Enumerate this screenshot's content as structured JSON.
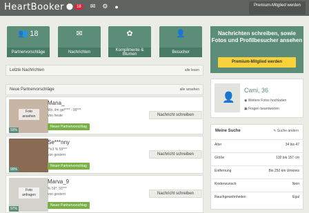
{
  "topbar": {
    "logo": "HeartBooker",
    "badge_count": "18",
    "premium_button": "Premium-Mitglied werden"
  },
  "tiles": [
    {
      "count": "18",
      "label": "Partnervorschläge"
    },
    {
      "label": "Nachrichten"
    },
    {
      "label": "Komplimente & Blumen"
    },
    {
      "label": "Besucher"
    }
  ],
  "latest": {
    "title": "Letzte Nachrichten",
    "more": "alle lesen"
  },
  "suggestions": {
    "title": "Neue Partnervorschläge",
    "more": "alle ansehen",
    "items": [
      {
        "name": "Mana_",
        "details": "Wo, ilm gel**** · 99***",
        "seen": "von heute",
        "tag": "Neuer Partnervorschlag",
        "photo_label": "Foto ansehen",
        "percent": "93%",
        "button": "Nachricht schreiben"
      },
      {
        "name": "Se***nny",
        "details": "**e3 % 59***",
        "seen": "von gestern",
        "tag": "Neuer Partnervorschlag",
        "photo_label": "",
        "percent": "99%",
        "button": "Nachricht schreiben"
      },
      {
        "name": "Marva_9",
        "details": "% 59*, 55***",
        "seen": "von gestern",
        "tag": "Neuer Partnervorschlag",
        "photo_label": "Foto anfragen",
        "percent": "97%",
        "button": "Nachricht schreiben"
      }
    ]
  },
  "promo": {
    "text": "Nachrichten schreiben, sowie Fotos und Profilbesucher ansehen",
    "button": "Premium-Mitglied werden"
  },
  "profile": {
    "name": "Cwni",
    "age": "36",
    "upload": "Weitere Fotos hochladen",
    "answer": "Fragen beantworten"
  },
  "search": {
    "title": "Meine Suche",
    "change": "Suche ändern",
    "rows": [
      {
        "label": "Alter",
        "value": "34 bis 47"
      },
      {
        "label": "Größe",
        "value": "132 bis 157 cm"
      },
      {
        "label": "Entfernung",
        "value": "Bis 250 km Umkreis"
      },
      {
        "label": "Kinderwunsch",
        "value": "Nein"
      },
      {
        "label": "Rauchgewohnheiten",
        "value": "Egal"
      }
    ]
  },
  "colors": {
    "brand": "#5b8d79",
    "accent": "#7bb046",
    "premium": "#f7d23b",
    "badge": "#e0233a"
  }
}
